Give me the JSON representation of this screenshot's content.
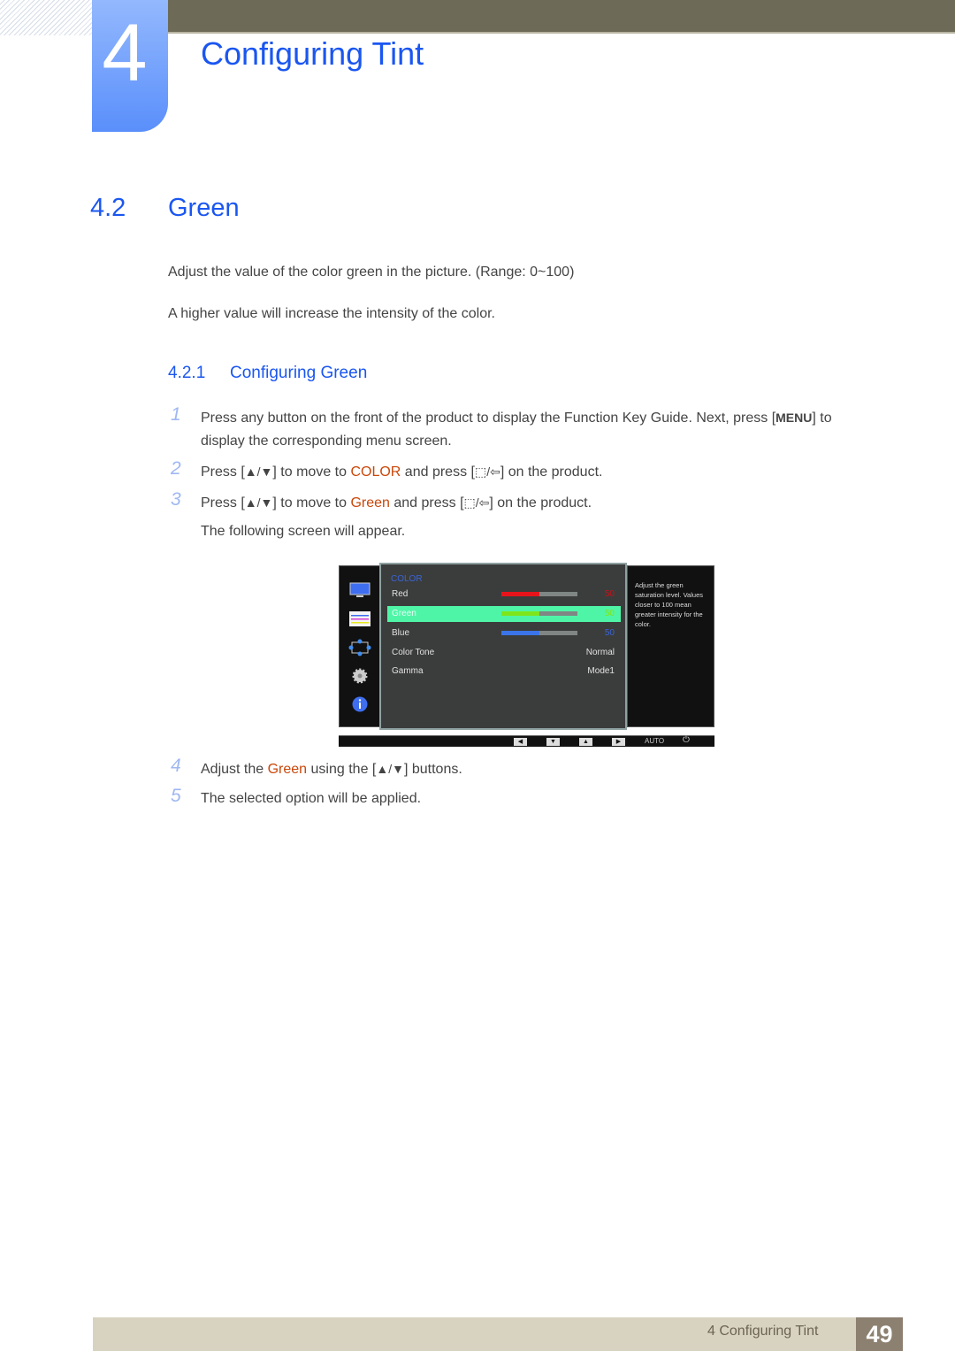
{
  "header": {
    "chapter_number": "4",
    "chapter_title": "Configuring Tint"
  },
  "section": {
    "number": "4.2",
    "title": "Green",
    "paragraphs": [
      "Adjust the value of the color green in the picture. (Range: 0~100)",
      "A higher value will increase the intensity of the color."
    ]
  },
  "subsection": {
    "number": "4.2.1",
    "title": "Configuring Green"
  },
  "steps": [
    {
      "num": "1",
      "a": "Press any button on the front of the product to display the Function Key Guide. Next, press [",
      "key": "MENU",
      "b": "] to",
      "line2": "display the corresponding menu screen."
    },
    {
      "num": "2",
      "a": "Press [",
      "arrows": "▲/▼",
      "b": "] to move to ",
      "hl": "COLOR",
      "c": " and press [",
      "enter": "⬚/⇦",
      "d": "] on the product."
    },
    {
      "num": "3",
      "a": "Press [",
      "arrows": "▲/▼",
      "b": "] to move to ",
      "hl": "Green",
      "c": " and press [",
      "enter": "⬚/⇦",
      "d": "] on the product.",
      "line2": "The following screen will appear."
    },
    {
      "num": "4",
      "a": "Adjust the ",
      "hl": "Green",
      "b": " using the [",
      "arrows": "▲/▼",
      "c": "] buttons."
    },
    {
      "num": "5",
      "a": "The selected option will be applied."
    }
  ],
  "osd": {
    "side_icons": [
      "monitor-icon",
      "color-sliders-icon",
      "size-position-icon",
      "gear-icon",
      "info-icon"
    ],
    "heading": "COLOR",
    "rows": [
      {
        "label": "Red",
        "value": "50",
        "level": 0.5,
        "bar_color": "#e8141b",
        "value_color": "#c0141a",
        "selected": false
      },
      {
        "label": "Green",
        "value": "50",
        "level": 0.5,
        "bar_color": "#7ee51a",
        "value_color": "#7ee51a",
        "selected": true
      },
      {
        "label": "Blue",
        "value": "50",
        "level": 0.5,
        "bar_color": "#3a74e8",
        "value_color": "#3a63d8",
        "selected": false
      },
      {
        "label": "Color Tone",
        "value": "Normal"
      },
      {
        "label": "Gamma",
        "value": "Mode1"
      }
    ],
    "help_text": "Adjust the green saturation level. Values closer to 100 mean greater intensity for the color.",
    "bottom_buttons": [
      "◀",
      "▼",
      "▲",
      "▶"
    ],
    "auto_label": "AUTO",
    "power_glyph": "⏻"
  },
  "footer": {
    "label": "4 Configuring Tint",
    "page": "49"
  }
}
